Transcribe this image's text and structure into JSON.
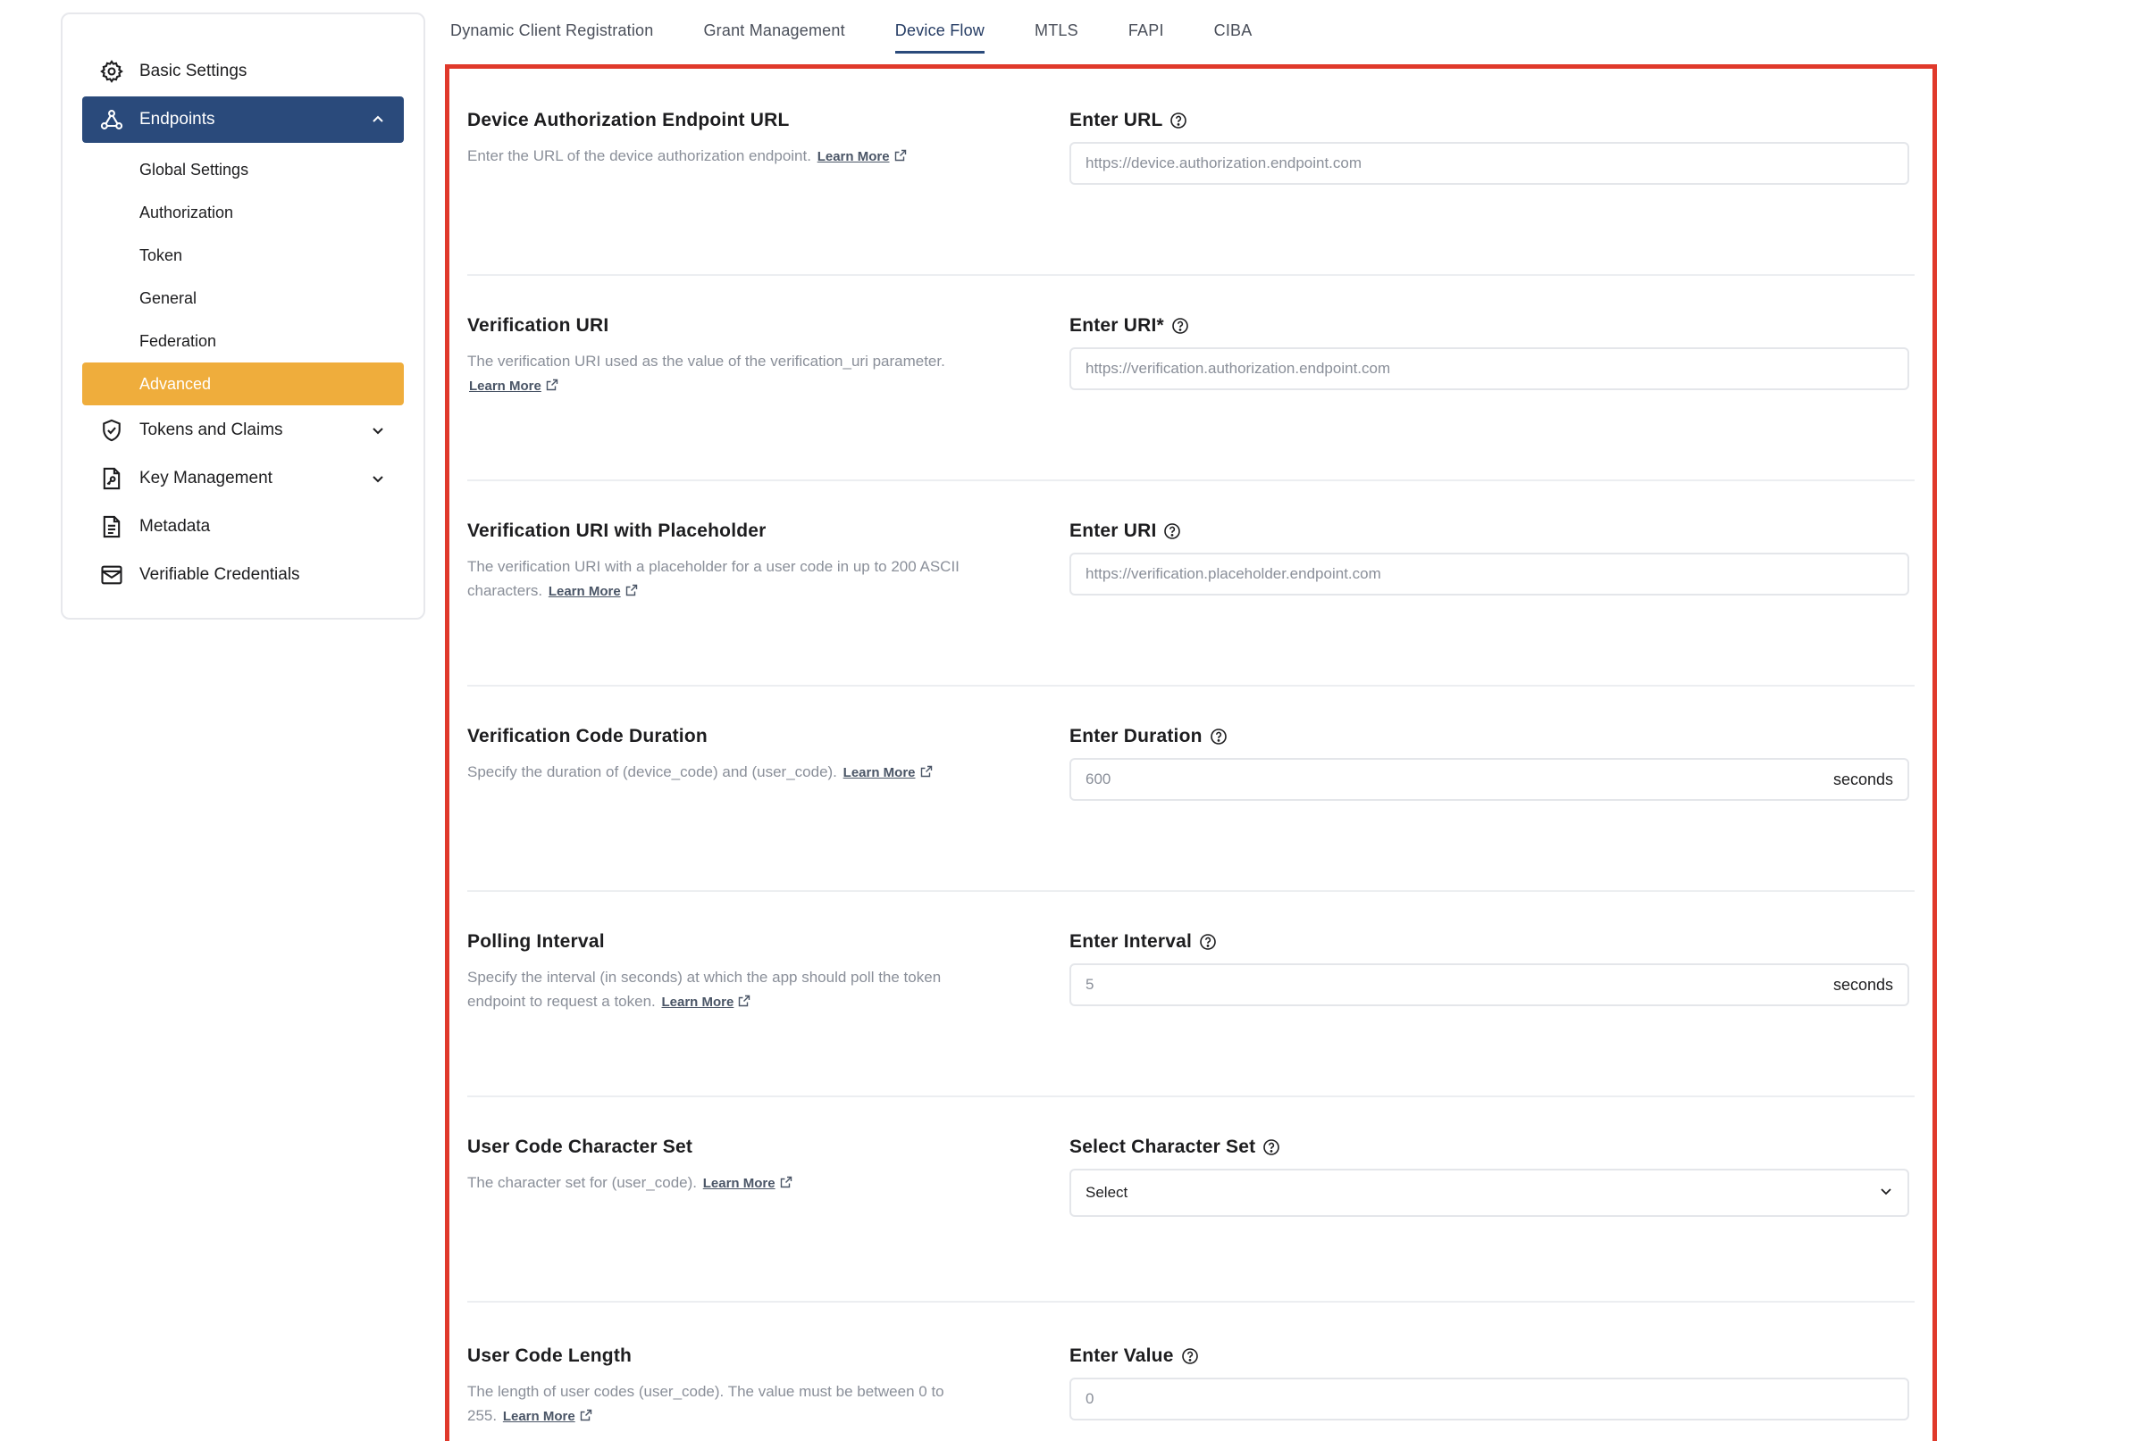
{
  "sidebar": {
    "basic_settings": "Basic Settings",
    "endpoints": "Endpoints",
    "endpoints_sub": [
      "Global Settings",
      "Authorization",
      "Token",
      "General",
      "Federation",
      "Advanced"
    ],
    "tokens_claims": "Tokens and Claims",
    "key_management": "Key Management",
    "metadata": "Metadata",
    "verifiable_credentials": "Verifiable Credentials"
  },
  "tabs": [
    "Dynamic Client Registration",
    "Grant Management",
    "Device Flow",
    "MTLS",
    "FAPI",
    "CIBA"
  ],
  "active_tab": "Device Flow",
  "learn_more": "Learn More",
  "fields": [
    {
      "title": "Device Authorization Endpoint URL",
      "desc": "Enter the URL of the device authorization endpoint.",
      "label": "Enter URL",
      "placeholder": "https://device.authorization.endpoint.com",
      "suffix": ""
    },
    {
      "title": "Verification URI",
      "desc": "The verification URI used as the value of the verification_uri parameter.",
      "label": "Enter URI*",
      "placeholder": "https://verification.authorization.endpoint.com",
      "suffix": ""
    },
    {
      "title": "Verification URI with Placeholder",
      "desc": "The verification URI with a placeholder for a user code in up to 200 ASCII characters.",
      "label": "Enter URI",
      "placeholder": "https://verification.placeholder.endpoint.com",
      "suffix": ""
    },
    {
      "title": "Verification Code Duration",
      "desc": "Specify the duration of (device_code) and (user_code).",
      "label": "Enter Duration",
      "placeholder": "600",
      "suffix": "seconds"
    },
    {
      "title": "Polling Interval",
      "desc": "Specify the interval (in seconds) at which the app should poll the token endpoint to request a token.",
      "label": "Enter Interval",
      "placeholder": "5",
      "suffix": "seconds"
    },
    {
      "title": "User Code Character Set",
      "desc": "The character set for (user_code).",
      "label": "Select Character Set",
      "placeholder": "Select",
      "suffix": ""
    },
    {
      "title": "User Code Length",
      "desc": "The length of user codes (user_code). The value must be between 0 to 255.",
      "label": "Enter Value",
      "placeholder": "0",
      "suffix": ""
    }
  ],
  "colors": {
    "active_nav": "#2a4a7b",
    "selected_sub": "#efad3c",
    "highlight_border": "#e0392b"
  }
}
